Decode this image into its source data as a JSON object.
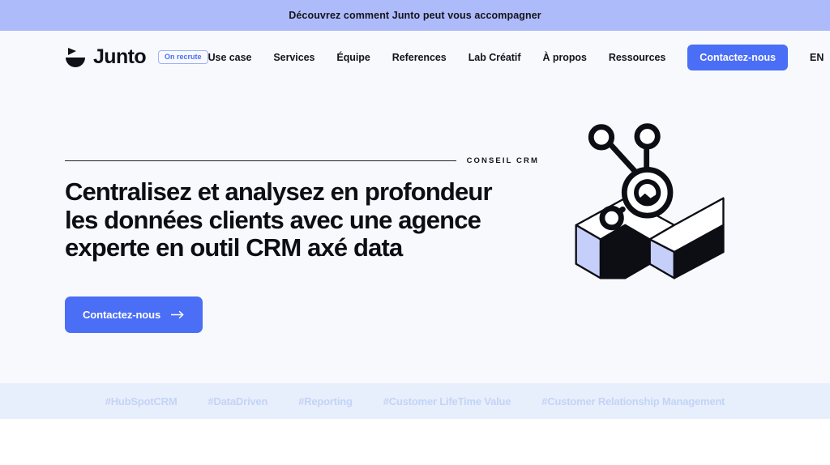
{
  "announcement": {
    "text": "Découvrez comment Junto peut vous accompagner",
    "background": "#aebbfb"
  },
  "brand": {
    "name": "Junto",
    "logo_icon": "junto-mark-icon",
    "badge": "On recrute"
  },
  "nav": {
    "links": [
      {
        "label": "Use case"
      },
      {
        "label": "Services"
      },
      {
        "label": "Équipe"
      },
      {
        "label": "References"
      },
      {
        "label": "Lab Créatif"
      },
      {
        "label": "À propos"
      },
      {
        "label": "Ressources"
      }
    ],
    "cta": "Contactez-nous",
    "language": "EN"
  },
  "hero": {
    "eyebrow": "CONSEIL CRM",
    "title_line1": "Centralisez et analysez en profondeur",
    "title_line2": "les données clients avec une agence",
    "title_line3": "experte en outil CRM axé data",
    "cta": "Contactez-nous",
    "cta_icon": "arrow-right-icon",
    "illustration_icon": "hubspot-sprocket-isometric-block-icon"
  },
  "tags": [
    {
      "label": "#HubSpotCRM"
    },
    {
      "label": "#DataDriven"
    },
    {
      "label": "#Reporting"
    },
    {
      "label": "#Customer LifeTime Value"
    },
    {
      "label": "#Customer Relationship Management"
    }
  ],
  "colors": {
    "accent_blue": "#4a6ef5",
    "banner_periwinkle": "#aebbfb",
    "page_background": "#f7f9fd",
    "tag_strip_background": "#e8effc",
    "tag_text": "#c3d3f7",
    "illustration_lavender": "#c6cffa",
    "ink": "#0d0d14"
  }
}
